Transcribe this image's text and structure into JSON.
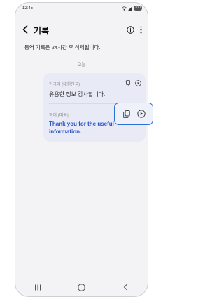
{
  "status_bar": {
    "time": "12:45",
    "battery": "100"
  },
  "app_bar": {
    "title": "기록"
  },
  "notice": "통역 기록은 24시간 후 삭제됩니다.",
  "date_label": "오늘",
  "entry": {
    "source_lang": "한국어 (대한민국)",
    "source_text": "유용한 정보 감사합니다.",
    "target_lang": "영어 (미국)",
    "target_text": "Thank you for the useful information."
  },
  "colors": {
    "accent": "#2f6fd8",
    "translation_text": "#2b54c6",
    "bubble": "#e8eaf6"
  }
}
